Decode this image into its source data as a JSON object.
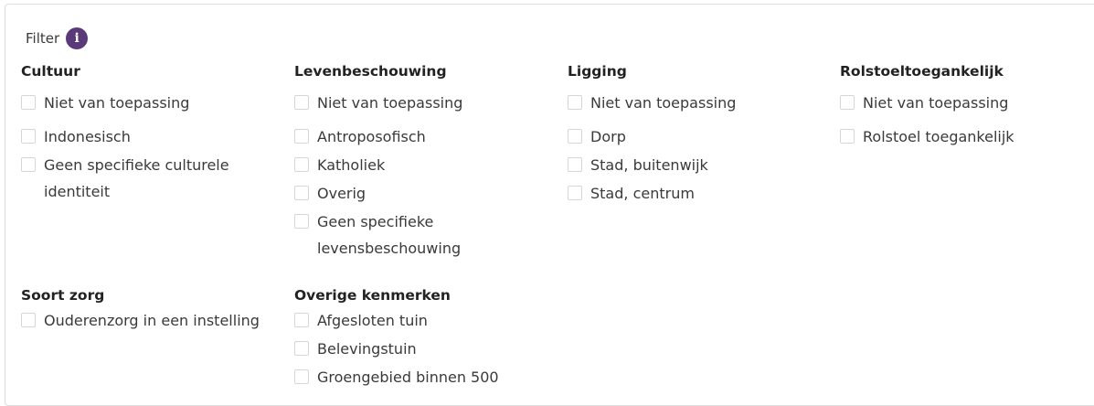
{
  "filter": {
    "label": "Filter",
    "info_glyph": "i",
    "info_color": "#5b3a7a"
  },
  "groups": {
    "cultuur": {
      "title": "Cultuur",
      "options": [
        "Niet van toepassing",
        "Indonesisch",
        "Geen specifieke culturele identiteit"
      ]
    },
    "levensbeschouwing": {
      "title": "Levenbeschouwing",
      "options": [
        "Niet van toepassing",
        "Antroposofisch",
        "Katholiek",
        "Overig",
        "Geen specifieke levensbeschouwing"
      ]
    },
    "ligging": {
      "title": "Ligging",
      "options": [
        "Niet van toepassing",
        "Dorp",
        "Stad, buitenwijk",
        "Stad, centrum"
      ]
    },
    "rolstoel": {
      "title": "Rolstoeltoegankelijk",
      "options": [
        "Niet van toepassing",
        "Rolstoel toegankelijk"
      ]
    },
    "soort_zorg": {
      "title": "Soort zorg",
      "options": [
        "Ouderenzorg in een instelling"
      ]
    },
    "overige": {
      "title": "Overige kenmerken",
      "options": [
        "Afgesloten tuin",
        "Belevingstuin",
        "Groengebied binnen 500"
      ]
    }
  }
}
